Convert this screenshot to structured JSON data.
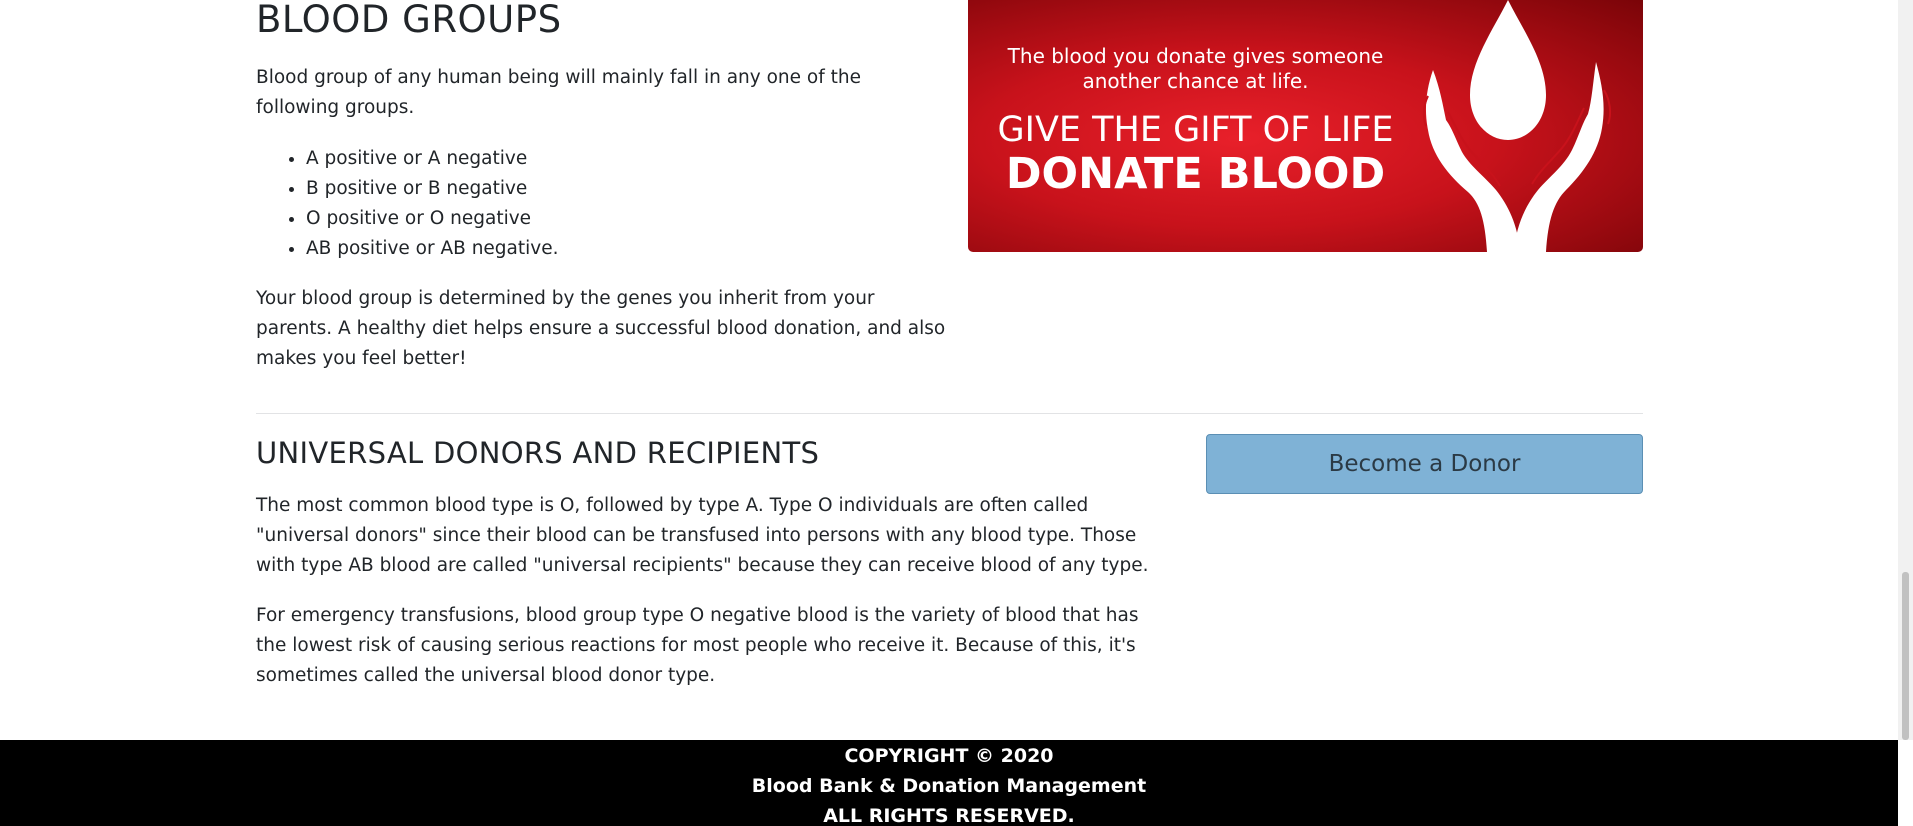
{
  "blood_groups": {
    "heading": "BLOOD GROUPS",
    "intro": "Blood group of any human being will mainly fall in any one of the following groups.",
    "groups": [
      "A positive or A negative",
      "B positive or B negative",
      "O positive or O negative",
      "AB positive or AB negative."
    ],
    "genes_text": "Your blood group is determined by the genes you inherit from your parents. A healthy diet helps ensure a successful blood donation, and also makes you feel better!"
  },
  "banner": {
    "line1": "The blood you donate gives someone another chance at life.",
    "line2": "GIVE THE GIFT OF LIFE",
    "line3": "DONATE BLOOD",
    "colors": {
      "primary": "#e8202a",
      "dark": "#7a0408"
    }
  },
  "universal": {
    "heading": "UNIVERSAL DONORS AND RECIPIENTS",
    "p1": "The most common blood type is O, followed by type A. Type O individuals are often called \"universal donors\" since their blood can be transfused into persons with any blood type. Those with type AB blood are called \"universal recipients\" because they can receive blood of any type.",
    "p2": "For emergency transfusions, blood group type O negative blood is the variety of blood that has the lowest risk of causing serious reactions for most people who receive it. Because of this, it's sometimes called the universal blood donor type."
  },
  "donor_button": {
    "label": "Become a Donor",
    "color": "#7fb2d6"
  },
  "footer": {
    "line1": "COPYRIGHT © 2020",
    "line2": "Blood Bank & Donation Management",
    "line3": "ALL RIGHTS RESERVED."
  }
}
